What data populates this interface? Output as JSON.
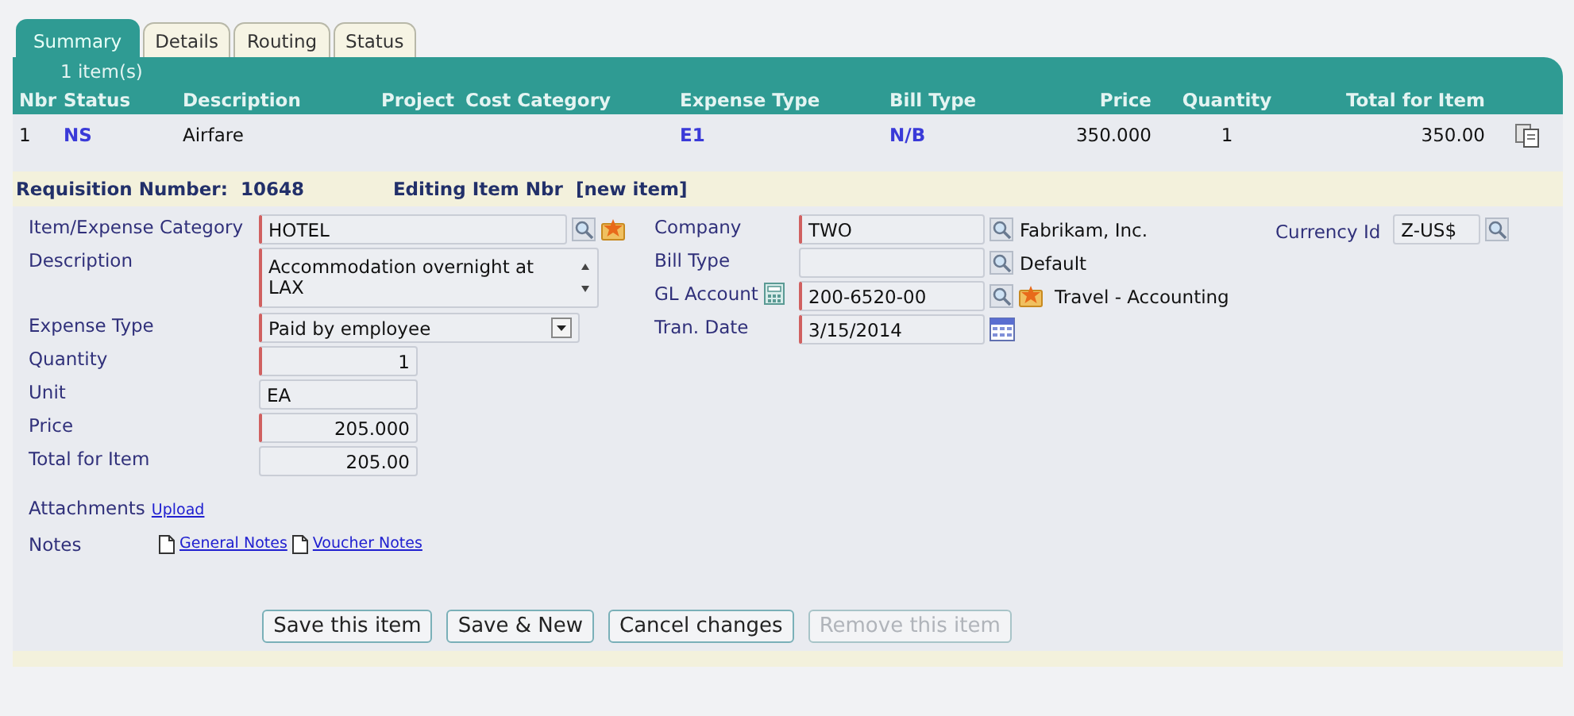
{
  "tabs": [
    {
      "label": "Summary",
      "selected": true
    },
    {
      "label": "Details",
      "selected": false
    },
    {
      "label": "Routing",
      "selected": false
    },
    {
      "label": "Status",
      "selected": false
    }
  ],
  "summary": {
    "count": "1 item(s)",
    "columns": [
      "Nbr",
      "Status",
      "Description",
      "Project",
      "Cost Category",
      "Expense Type",
      "Bill Type",
      "Price",
      "Quantity",
      "Total for Item"
    ],
    "rows": [
      {
        "nbr": "1",
        "status": "NS",
        "description": "Airfare",
        "expense_type": "E1",
        "bill_type": "N/B",
        "price": "350.000",
        "quantity": "1",
        "total": "350.00"
      }
    ]
  },
  "requisition": {
    "label": "Requisition Number:",
    "number": "10648",
    "editing_label": "Editing Item Nbr",
    "editing_value": "[new item]"
  },
  "left_fields": [
    {
      "label": "Item/Expense Category",
      "kind": "lookup-fav",
      "value": "HOTEL",
      "required": true
    },
    {
      "label": "Description",
      "kind": "textarea",
      "value": "Accommodation overnight at LAX",
      "required": true
    },
    {
      "label": "Expense Type",
      "kind": "select",
      "value": "Paid by employee",
      "required": true
    },
    {
      "label": "Quantity",
      "kind": "number",
      "value": "1",
      "required": true
    },
    {
      "label": "Unit",
      "kind": "short",
      "value": "EA",
      "required": false
    },
    {
      "label": "Price",
      "kind": "number",
      "value": "205.000",
      "required": true
    },
    {
      "label": "Total for Item",
      "kind": "number",
      "value": "205.00",
      "required": false
    }
  ],
  "right_fields": [
    {
      "label": "Company",
      "kind": "lookup",
      "value": "TWO",
      "note": "Fabrikam, Inc.",
      "required": true
    },
    {
      "label": "Bill Type",
      "kind": "lookup",
      "note": "Default",
      "required": false
    },
    {
      "label": "GL Account",
      "kind": "account",
      "value": "200-6520-00",
      "note": "Travel - Accounting",
      "required": true
    },
    {
      "label": "Tran. Date",
      "kind": "date",
      "value": "3/15/2014",
      "required": true
    }
  ],
  "currency": {
    "label": "Currency Id",
    "value": "Z-US$"
  },
  "attachments": {
    "label": "Attachments",
    "link": "Upload"
  },
  "notes": {
    "label": "Notes",
    "links": [
      "General Notes",
      "Voucher Notes"
    ]
  },
  "buttons": [
    {
      "label": "Save this item",
      "disabled": false
    },
    {
      "label": "Save & New",
      "disabled": false
    },
    {
      "label": "Cancel changes",
      "disabled": false
    },
    {
      "label": "Remove this item",
      "disabled": true
    }
  ]
}
